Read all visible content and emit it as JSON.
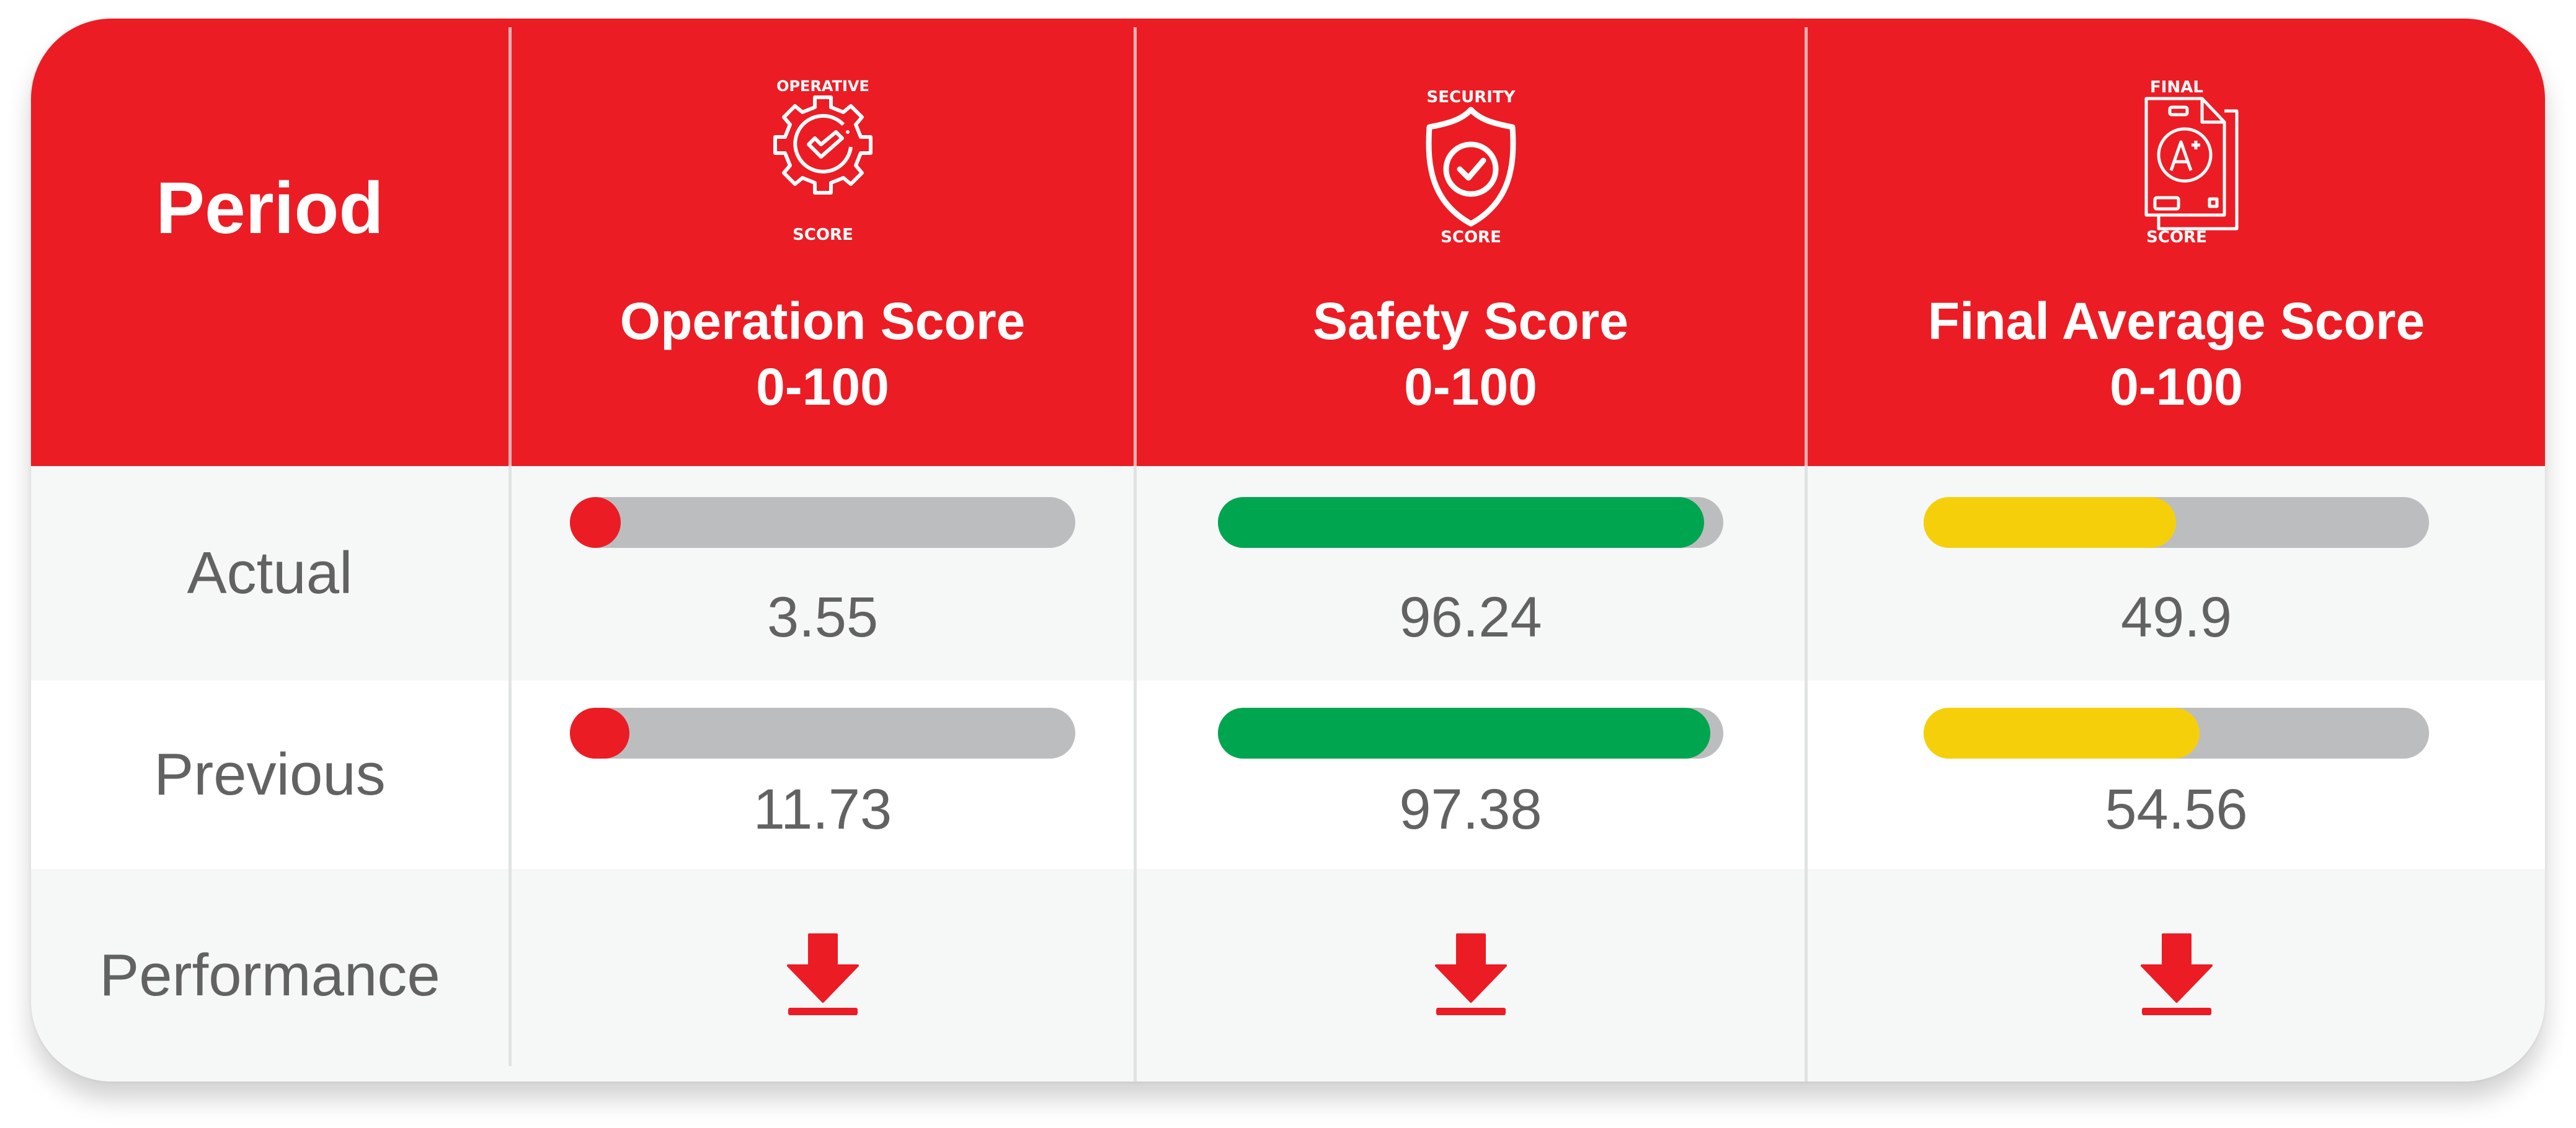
{
  "header": {
    "period_label": "Period",
    "columns": [
      {
        "icon": "gear-check-icon",
        "icon_top_text": "OPERATIVE",
        "icon_bottom_text": "SCORE",
        "title": "Operation Score",
        "range": "0-100"
      },
      {
        "icon": "shield-check-icon",
        "icon_top_text": "SECURITY",
        "icon_bottom_text": "SCORE",
        "title": "Safety Score",
        "range": "0-100"
      },
      {
        "icon": "document-grade-a-plus-icon",
        "icon_top_text": "FINAL",
        "icon_bottom_text": "SCORE",
        "title": "Final Average Score",
        "range": "0-100"
      }
    ]
  },
  "rows": {
    "actual": {
      "label": "Actual",
      "cells": [
        {
          "value": "3.55",
          "fill_percent": 3.55,
          "color": "#ec1c24"
        },
        {
          "value": "96.24",
          "fill_percent": 96.24,
          "color": "#00a550"
        },
        {
          "value": "49.9",
          "fill_percent": 49.9,
          "color": "#f5d00a"
        }
      ]
    },
    "previous": {
      "label": "Previous",
      "cells": [
        {
          "value": "11.73",
          "fill_percent": 11.73,
          "color": "#ec1c24"
        },
        {
          "value": "97.38",
          "fill_percent": 97.38,
          "color": "#00a550"
        },
        {
          "value": "54.56",
          "fill_percent": 54.56,
          "color": "#f5d00a"
        }
      ]
    },
    "performance": {
      "label": "Performance",
      "cells": [
        {
          "icon": "download-arrow-down-icon",
          "trend": "down",
          "color": "#ec1c24"
        },
        {
          "icon": "download-arrow-down-icon",
          "trend": "down",
          "color": "#ec1c24"
        },
        {
          "icon": "download-arrow-down-icon",
          "trend": "down",
          "color": "#ec1c24"
        }
      ]
    }
  },
  "colors": {
    "header_bg": "#ec1c24",
    "track": "#bcbdbf",
    "text": "#626262"
  }
}
